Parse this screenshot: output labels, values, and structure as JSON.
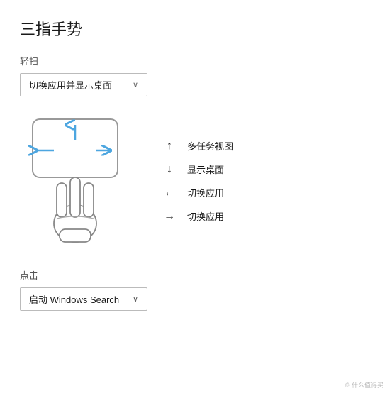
{
  "title": "三指手势",
  "swipe_section": {
    "label": "轻扫",
    "dropdown_value": "切换应用并显示桌面",
    "dropdown_chevron": "∨"
  },
  "legend": {
    "items": [
      {
        "arrow": "↑",
        "text": "多任务视图"
      },
      {
        "arrow": "↓",
        "text": "显示桌面"
      },
      {
        "arrow": "←",
        "text": "切换应用"
      },
      {
        "arrow": "→",
        "text": "切换应用"
      }
    ]
  },
  "tap_section": {
    "label": "点击",
    "dropdown_value": "启动 Windows Search",
    "dropdown_chevron": "∨"
  },
  "watermark": "© 什么值得买"
}
